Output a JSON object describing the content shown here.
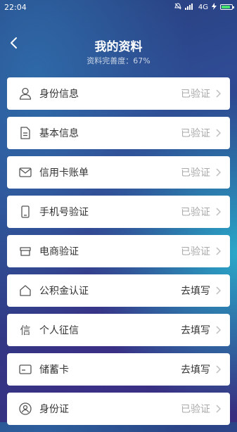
{
  "status_bar": {
    "time": "22:04",
    "network": "4G",
    "battery_color": "#46e26b"
  },
  "header": {
    "title": "我的资料",
    "subtitle": "资料完善度：67%"
  },
  "items": [
    {
      "icon": "person-icon",
      "label": "身份信息",
      "status": "已验证",
      "state": "verified"
    },
    {
      "icon": "document-icon",
      "label": "基本信息",
      "status": "已验证",
      "state": "verified"
    },
    {
      "icon": "mail-icon",
      "label": "信用卡账单",
      "status": "已验证",
      "state": "verified"
    },
    {
      "icon": "phone-icon",
      "label": "手机号验证",
      "status": "已验证",
      "state": "verified"
    },
    {
      "icon": "store-icon",
      "label": "电商验证",
      "status": "已验证",
      "state": "verified"
    },
    {
      "icon": "house-icon",
      "label": "公积金认证",
      "status": "去填写",
      "state": "todo"
    },
    {
      "icon": "credit-icon",
      "label": "个人征信",
      "status": "去填写",
      "state": "todo"
    },
    {
      "icon": "card-icon",
      "label": "储蓄卡",
      "status": "去填写",
      "state": "todo"
    },
    {
      "icon": "id-icon",
      "label": "身份证",
      "status": "已验证",
      "state": "verified"
    }
  ],
  "colors": {
    "verified_text": "#a9a9a9",
    "todo_text": "#333333"
  }
}
